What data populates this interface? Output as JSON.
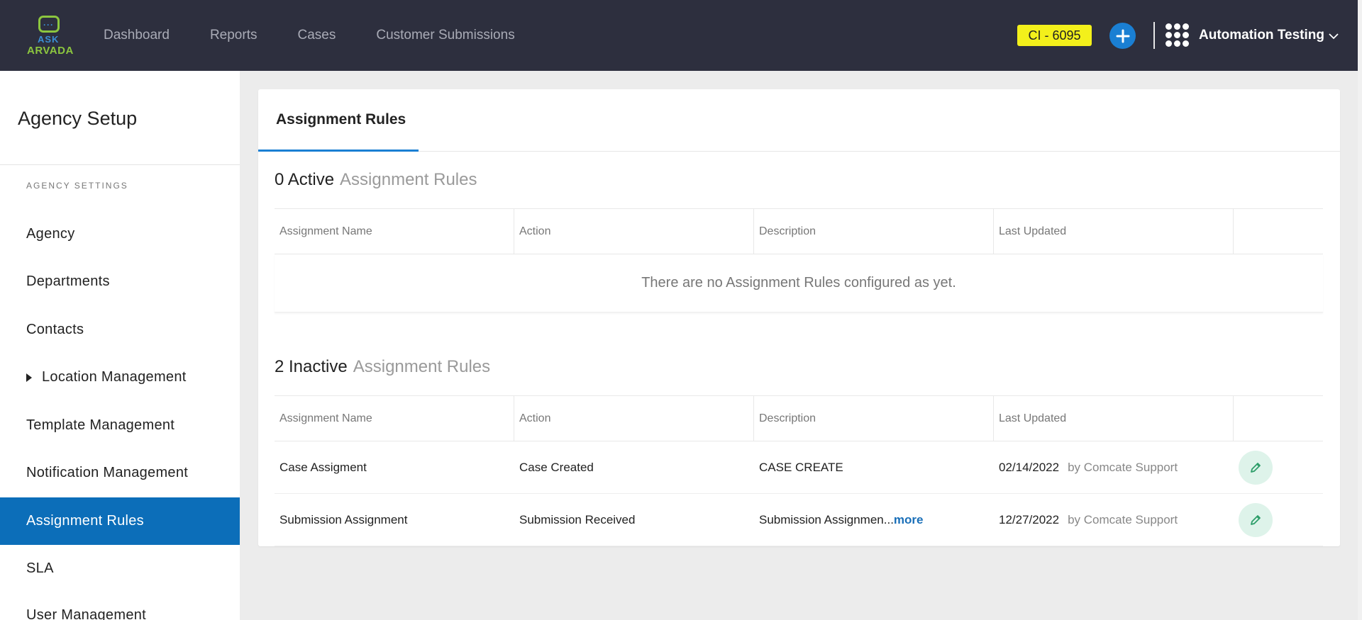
{
  "header": {
    "logo": {
      "ask": "ASK",
      "arvada": "ARVADA"
    },
    "nav": [
      "Dashboard",
      "Reports",
      "Cases",
      "Customer Submissions"
    ],
    "ci_badge": "CI - 6095",
    "user_name": "Automation Testing",
    "icons": {
      "add": "plus-icon",
      "apps": "apps-grid-icon",
      "dropdown": "chevron-down-icon"
    },
    "colors": {
      "bar": "#2d2f3e",
      "badge": "#f3f01b",
      "accent": "#1a7fd3"
    }
  },
  "sidebar": {
    "title": "Agency Setup",
    "section_label": "AGENCY SETTINGS",
    "items": [
      {
        "label": "Agency",
        "active": false
      },
      {
        "label": "Departments",
        "active": false
      },
      {
        "label": "Contacts",
        "active": false
      },
      {
        "label": "Location Management",
        "active": false,
        "expandable": true
      },
      {
        "label": "Template Management",
        "active": false
      },
      {
        "label": "Notification Management",
        "active": false
      },
      {
        "label": "Assignment Rules",
        "active": true
      },
      {
        "label": "SLA",
        "active": false
      },
      {
        "label": "User Management",
        "active": false
      }
    ],
    "active_color": "#0c6eb9"
  },
  "main": {
    "tab": "Assignment Rules",
    "active_section": {
      "count_label": "0 Active",
      "title": "Assignment Rules",
      "columns": [
        "Assignment Name",
        "Action",
        "Description",
        "Last Updated",
        ""
      ],
      "empty_message": "There are no Assignment Rules configured as yet."
    },
    "inactive_section": {
      "count_label": "2 Inactive",
      "title": "Assignment Rules",
      "columns": [
        "Assignment Name",
        "Action",
        "Description",
        "Last Updated",
        ""
      ],
      "rows": [
        {
          "name": "Case Assigment",
          "action": "Case Created",
          "description": "CASE CREATE",
          "more": "",
          "date": "02/14/2022",
          "by": "by Comcate Support"
        },
        {
          "name": "Submission Assignment",
          "action": "Submission Received",
          "description": "Submission Assignmen...",
          "more": "more",
          "date": "12/27/2022",
          "by": "by Comcate Support"
        }
      ],
      "row_action_icon": "pencil-icon"
    }
  }
}
